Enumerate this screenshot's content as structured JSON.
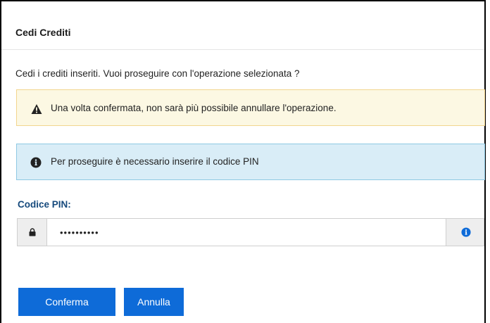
{
  "dialog": {
    "title": "Cedi Crediti",
    "message": "Cedi i crediti inseriti. Vuoi proseguire con l'operazione selezionata ?"
  },
  "alerts": {
    "warning": {
      "icon": "warning-triangle-icon",
      "text": "Una volta confermata, non sarà più possibile annullare l'operazione.",
      "background": "#fcf8e3"
    },
    "info": {
      "icon": "info-circle-icon",
      "text": "Per proseguire è necessario inserire il codice PIN",
      "background": "#d9edf7"
    }
  },
  "pin": {
    "label": "Codice PIN:",
    "value": "••••••••••",
    "left_icon": "lock-icon",
    "right_icon": "info-circle-icon"
  },
  "buttons": {
    "confirm_label": "Conferma",
    "cancel_label": "Annulla",
    "primary_color": "#0e6bd8"
  }
}
